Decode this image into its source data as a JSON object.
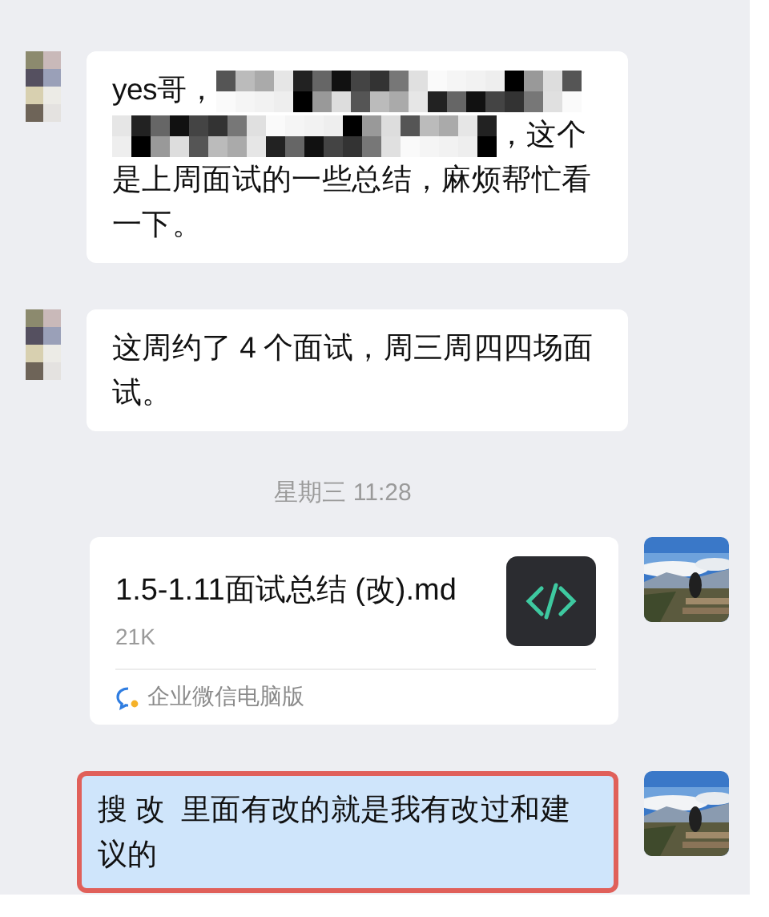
{
  "messages": [
    {
      "kind": "text",
      "outgoing": false,
      "highlighted": false,
      "parts": [
        {
          "kind": "text",
          "text": "yes哥，"
        },
        {
          "kind": "mosaic"
        },
        {
          "kind": "text",
          "text": "，这个是上周面试的一些总结，麻烦帮忙看一下。"
        }
      ]
    },
    {
      "kind": "text",
      "outgoing": false,
      "highlighted": false,
      "parts": [
        {
          "kind": "text",
          "text": "这周约了 4 个面试，周三周四四场面试。"
        }
      ]
    },
    {
      "kind": "time",
      "text": "星期三 11:28"
    },
    {
      "kind": "file",
      "outgoing": true,
      "file_name": "1.5-1.11面试总结 (改).md",
      "size": "21K",
      "source": "企业微信电脑版"
    },
    {
      "kind": "text",
      "outgoing": true,
      "highlighted": true,
      "parts": [
        {
          "kind": "text",
          "text": "搜 改  里面有改的就是我有改过和建议的"
        }
      ]
    }
  ]
}
